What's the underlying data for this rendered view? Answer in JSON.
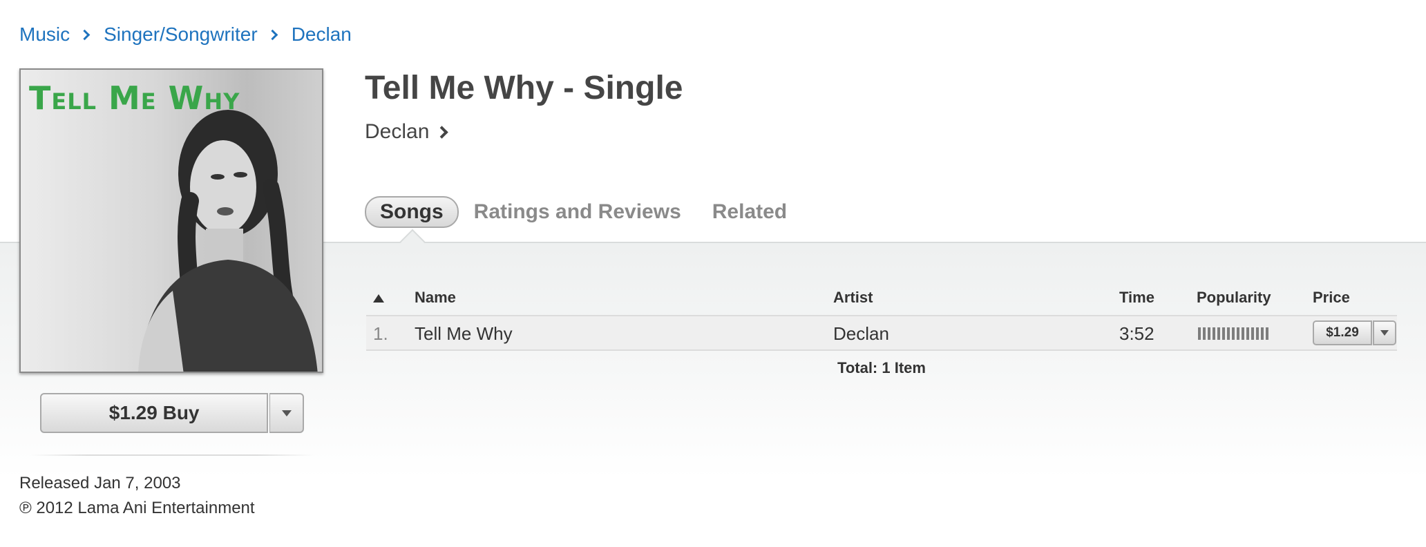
{
  "breadcrumb": {
    "items": [
      "Music",
      "Singer/Songwriter",
      "Declan"
    ]
  },
  "artwork": {
    "title_text": "Tell Me Why",
    "accent_color": "#3aa64a"
  },
  "buy": {
    "label": "$1.29 Buy"
  },
  "meta": {
    "released": "Released Jan 7, 2003",
    "copyright": "℗ 2012 Lama Ani Entertainment"
  },
  "header": {
    "title": "Tell Me Why - Single",
    "artist": "Declan"
  },
  "tabs": [
    {
      "label": "Songs",
      "active": true
    },
    {
      "label": "Ratings and Reviews",
      "active": false
    },
    {
      "label": "Related",
      "active": false
    }
  ],
  "table": {
    "columns": {
      "name": "Name",
      "artist": "Artist",
      "time": "Time",
      "popularity": "Popularity",
      "price": "Price"
    },
    "rows": [
      {
        "num": "1.",
        "name": "Tell Me Why",
        "artist": "Declan",
        "time": "3:52",
        "popularity_fraction": 1.0,
        "price": "$1.29"
      }
    ],
    "total": "Total: 1 Item"
  },
  "colors": {
    "link": "#1e73be",
    "band_bg": "#eef0f0"
  }
}
